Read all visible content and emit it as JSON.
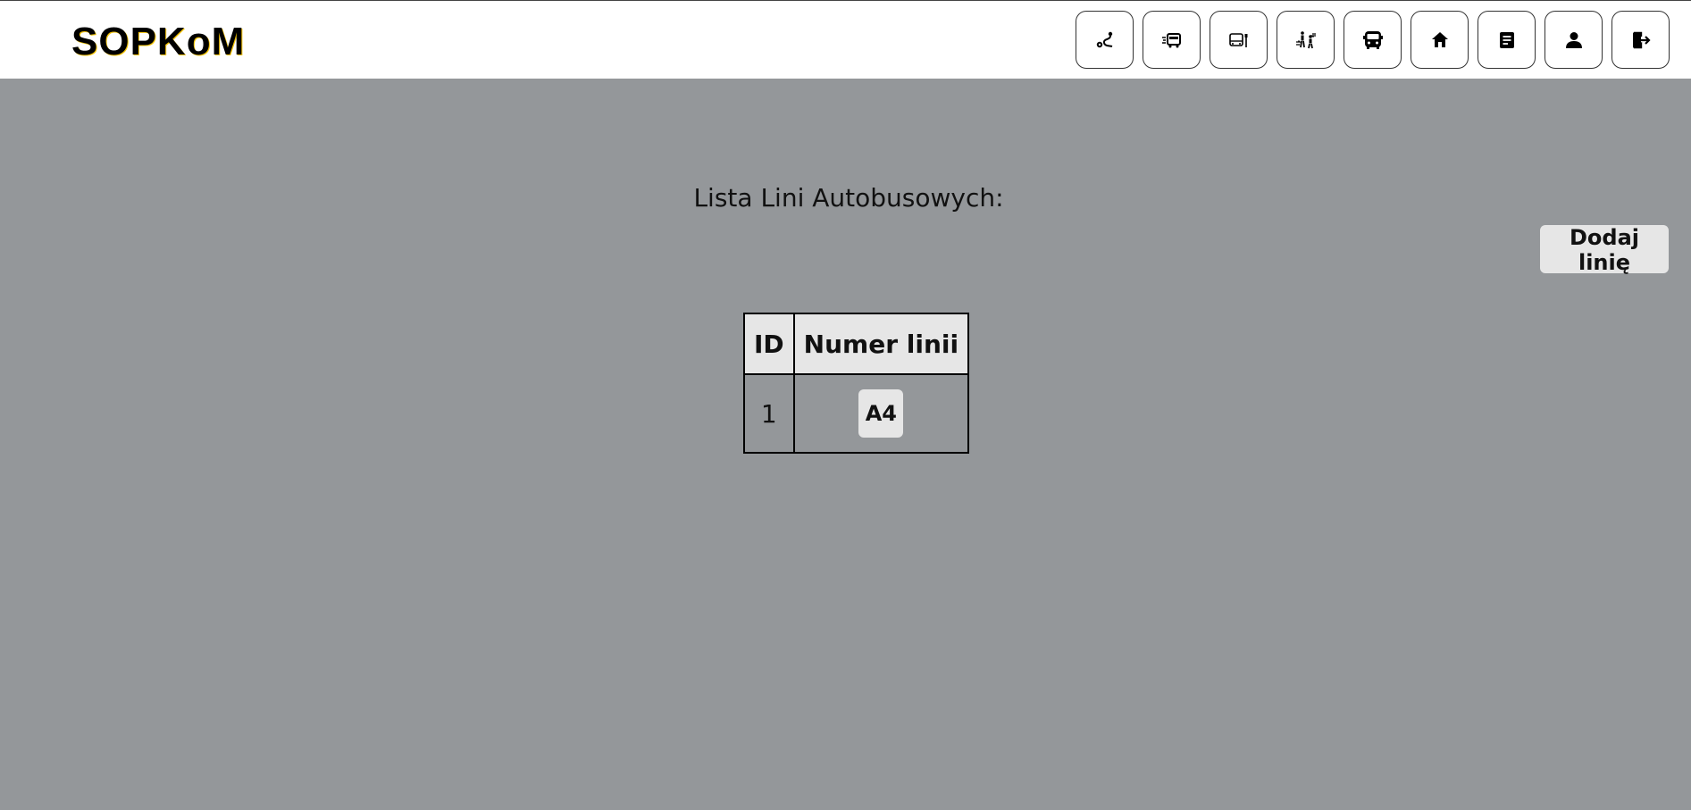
{
  "app": {
    "logo": "SOPKoM"
  },
  "nav": {
    "items": [
      {
        "icon": "route-icon"
      },
      {
        "icon": "bus-schedule-icon"
      },
      {
        "icon": "bus-stop-icon"
      },
      {
        "icon": "transfer-icon"
      },
      {
        "icon": "bus-icon"
      },
      {
        "icon": "home-icon"
      },
      {
        "icon": "document-icon"
      },
      {
        "icon": "user-icon"
      },
      {
        "icon": "logout-icon"
      }
    ]
  },
  "main": {
    "title": "Lista Lini Autobusowych:",
    "add_button_label": "Dodaj linię",
    "table": {
      "headers": [
        "ID",
        "Numer linii"
      ],
      "rows": [
        {
          "id": "1",
          "line": "A4"
        }
      ]
    }
  }
}
